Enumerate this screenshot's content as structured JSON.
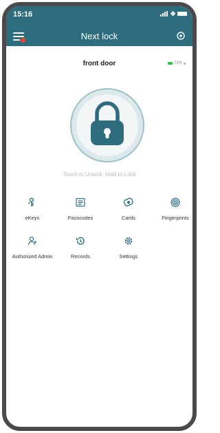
{
  "status": {
    "time": "15:16"
  },
  "header": {
    "title": "Next lock"
  },
  "lock": {
    "name": "front door",
    "battery": "73%",
    "hint": "Touch to Unlock, Hold to Lock"
  },
  "menu": [
    {
      "label": "eKeys",
      "icon": "ekey-icon"
    },
    {
      "label": "Passcodes",
      "icon": "passcode-icon"
    },
    {
      "label": "Cards",
      "icon": "card-icon"
    },
    {
      "label": "Fingerprints",
      "icon": "fingerprint-icon"
    },
    {
      "label": "Authorized Admin",
      "icon": "admin-icon"
    },
    {
      "label": "Records",
      "icon": "records-icon"
    },
    {
      "label": "Settings",
      "icon": "settings-icon"
    }
  ],
  "colors": {
    "header": "#2e6d80",
    "accent": "#2e6d80",
    "badge": "#e8443a",
    "battery": "#35c24b"
  }
}
